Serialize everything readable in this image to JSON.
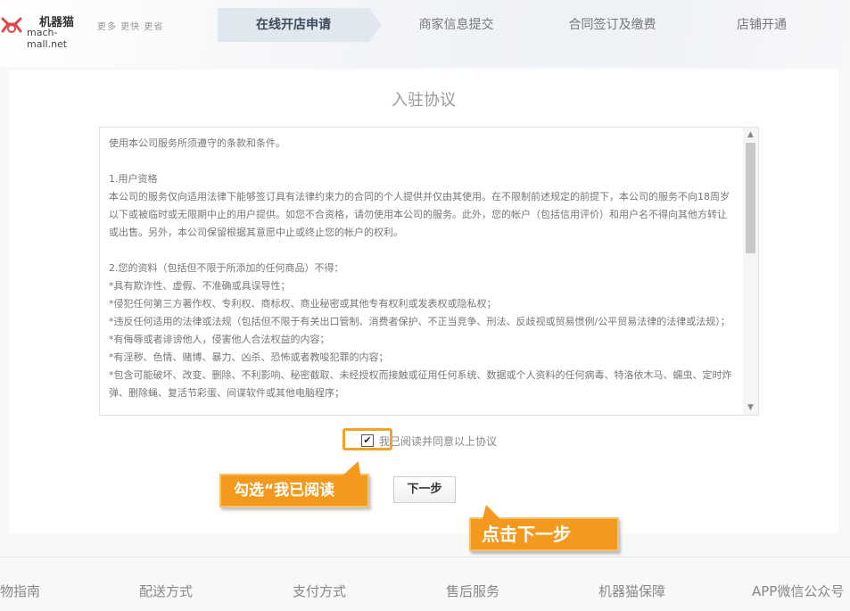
{
  "header": {
    "logo_name": "机器猫",
    "logo_url": "mach-mall.net",
    "slogan": "更多 更快 更省",
    "steps": [
      {
        "label": "在线开店申请",
        "active": true
      },
      {
        "label": "商家信息提交",
        "active": false
      },
      {
        "label": "合同签订及缴费",
        "active": false
      },
      {
        "label": "店铺开通",
        "active": false
      }
    ]
  },
  "main": {
    "title": "入驻协议",
    "agreement_text": "使用本公司服务所须遵守的条款和条件。\n\n1.用户资格\n本公司的服务仅向适用法律下能够签订具有法律约束力的合同的个人提供并仅由其使用。在不限制前述规定的前提下，本公司的服务不向18周岁以下或被临时或无限期中止的用户提供。如您不合资格，请勿使用本公司的服务。此外，您的帐户（包括信用评价）和用户名不得向其他方转让或出售。另外，本公司保留根据其意愿中止或终止您的帐户的权利。\n\n2.您的资料（包括但不限于所添加的任何商品）不得：\n*具有欺诈性、虚假、不准确或具误导性；\n*侵犯任何第三方著作权、专利权、商标权、商业秘密或其他专有权利或发表权或隐私权；\n*违反任何适用的法律或法规（包括但不限于有关出口管制、消费者保护、不正当竞争、刑法、反歧视或贸易惯例/公平贸易法律的法律或法规）；\n*有侮辱或者诽谤他人，侵害他人合法权益的内容；\n*有淫秽、色情、赌博、暴力、凶杀、恐怖或者教唆犯罪的内容；\n*包含可能破坏、改变、删除、不利影响、秘密截取、未经授权而接触或征用任何系统、数据或个人资料的任何病毒、特洛依木马、蠕虫、定时炸弹、删除蝇、复活节彩蛋、间谍软件或其他电脑程序；",
    "agree_checked": true,
    "agree_label": "我已阅读并同意以上协议",
    "next_button": "下一步"
  },
  "callouts": {
    "check_hint": "勾选“我已阅读",
    "next_hint": "点击下一步"
  },
  "footer": {
    "items": [
      "物指南",
      "配送方式",
      "支付方式",
      "售后服务",
      "机器猫保障",
      "APP微信公众号"
    ]
  },
  "colors": {
    "accent_orange": "#f39a1e",
    "active_step_bg": "#e1e7ee"
  }
}
